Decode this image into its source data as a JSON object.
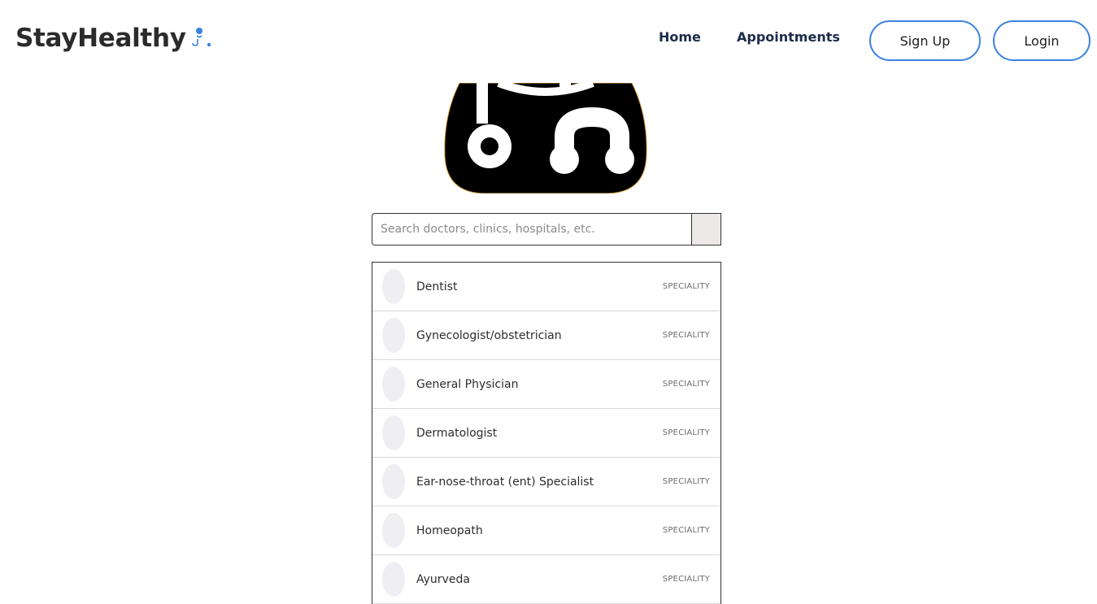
{
  "navbar": {
    "brand": "StayHealthy",
    "brand_icon": "doctor-stethoscope-icon",
    "accent_color": "#3b82e0",
    "links": [
      {
        "label": "Home"
      },
      {
        "label": "Appointments"
      }
    ],
    "signup_label": "Sign Up",
    "login_label": "Login"
  },
  "hero": {
    "icon": "stethoscope-icon"
  },
  "search": {
    "placeholder": "Search doctors, clinics, hospitals, etc.",
    "value": ""
  },
  "results": [
    {
      "name": "Dentist",
      "type": "SPECIALITY"
    },
    {
      "name": "Gynecologist/obstetrician",
      "type": "SPECIALITY"
    },
    {
      "name": "General Physician",
      "type": "SPECIALITY"
    },
    {
      "name": "Dermatologist",
      "type": "SPECIALITY"
    },
    {
      "name": "Ear-nose-throat (ent) Specialist",
      "type": "SPECIALITY"
    },
    {
      "name": "Homeopath",
      "type": "SPECIALITY"
    },
    {
      "name": "Ayurveda",
      "type": "SPECIALITY"
    }
  ]
}
